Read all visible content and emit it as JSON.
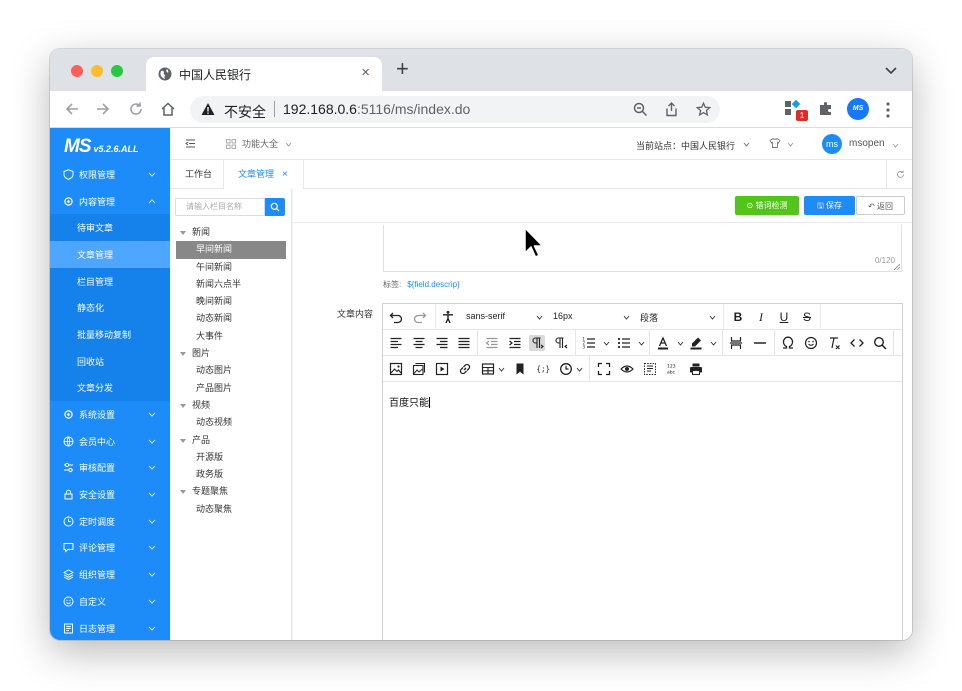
{
  "browser": {
    "tab_title": "中国人民银行",
    "tab_close": "×",
    "new_tab": "+",
    "insecure_label": "不安全",
    "url_host": "192.168.0.6",
    "url_rest": ":5116/ms/index.do",
    "extension_badge": "1",
    "profile_text": "MS"
  },
  "sidebar": {
    "logo": "MS",
    "version": "v5.2.6.ALL",
    "items": [
      {
        "label": "权限管理",
        "icon": "shield-icon"
      },
      {
        "label": "内容管理",
        "icon": "gear-icon"
      },
      {
        "label": "系统设置",
        "icon": "gear-icon"
      },
      {
        "label": "会员中心",
        "icon": "globe-icon"
      },
      {
        "label": "审核配置",
        "icon": "sliders-icon"
      },
      {
        "label": "安全设置",
        "icon": "lock-icon"
      },
      {
        "label": "定时调度",
        "icon": "clock-icon"
      },
      {
        "label": "评论管理",
        "icon": "comment-icon"
      },
      {
        "label": "组织管理",
        "icon": "layers-icon"
      },
      {
        "label": "自定义",
        "icon": "smile-icon"
      },
      {
        "label": "日志管理",
        "icon": "log-icon"
      }
    ],
    "subitems": [
      "待审文章",
      "文章管理",
      "栏目管理",
      "静态化",
      "批量移动复制",
      "回收站",
      "文章分发"
    ],
    "active_sub": "文章管理"
  },
  "topbar": {
    "funcs": "功能大全",
    "site_label": "当前站点：中国人民银行",
    "avatar": "ms",
    "user": "msopen"
  },
  "pagetabs": {
    "tab1": "工作台",
    "tab2": "文章管理",
    "tab2_close": "×"
  },
  "tree": {
    "search_placeholder": "请输入栏目名称",
    "nodes": [
      {
        "label": "新闻",
        "root": true
      },
      {
        "label": "早间新闻",
        "selected": true
      },
      {
        "label": "午间新闻"
      },
      {
        "label": "新闻六点半"
      },
      {
        "label": "晚间新闻"
      },
      {
        "label": "动态新闻"
      },
      {
        "label": "大事件"
      },
      {
        "label": "图片",
        "root": true
      },
      {
        "label": "动态图片"
      },
      {
        "label": "产品图片"
      },
      {
        "label": "视频",
        "root": true
      },
      {
        "label": "动态视频"
      },
      {
        "label": "产品",
        "root": true
      },
      {
        "label": "开源版"
      },
      {
        "label": "政务版"
      },
      {
        "label": "专题聚焦",
        "root": true
      },
      {
        "label": "动态聚焦"
      }
    ]
  },
  "content": {
    "btn_check": "⊙ 错词检测",
    "btn_save": "🖫 保存",
    "btn_back": "↶ 返回",
    "desc_count": "0/120",
    "tag_label": "标签:",
    "tag_code": "${field.descrip}",
    "content_label": "文章内容"
  },
  "editor": {
    "font_family": "sans-serif",
    "font_size": "16px",
    "block_format": "段落",
    "body_text": "百度只能"
  }
}
